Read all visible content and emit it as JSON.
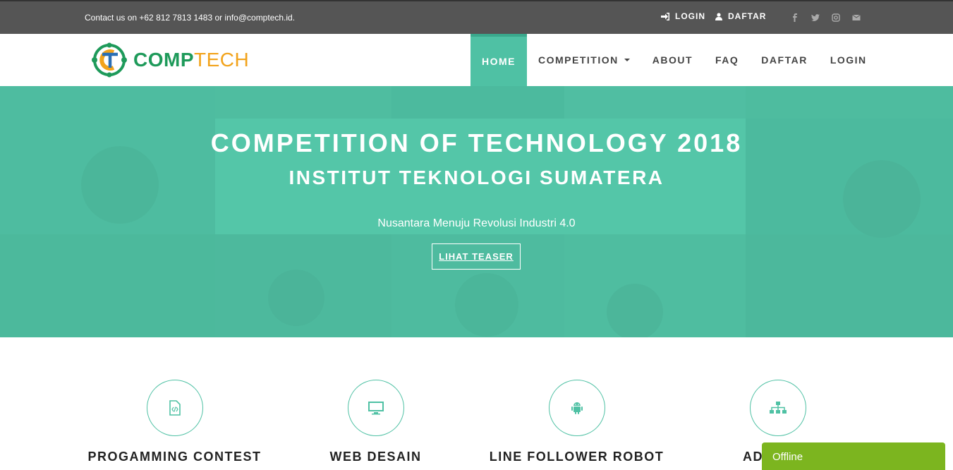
{
  "topbar": {
    "contact": "Contact us on +62 812 7813 1483 or info@comptech.id.",
    "login_label": "LOGIN",
    "daftar_label": "DAFTAR",
    "social": [
      "facebook-icon",
      "twitter-icon",
      "instagram-icon",
      "envelope-icon"
    ]
  },
  "brand": {
    "logo_part1": "COMP",
    "logo_part2": "TECH",
    "color_green": "#1e9a5a",
    "color_orange": "#f2a31b"
  },
  "nav": {
    "items": [
      {
        "label": "HOME",
        "active": true
      },
      {
        "label": "COMPETITION",
        "dropdown": true
      },
      {
        "label": "ABOUT"
      },
      {
        "label": "FAQ"
      },
      {
        "label": "DAFTAR"
      },
      {
        "label": "LOGIN"
      }
    ],
    "accent": "#4fc1a4"
  },
  "hero": {
    "title": "COMPETITION OF TECHNOLOGY 2018",
    "subtitle": "INSTITUT TEKNOLOGI SUMATERA",
    "tagline": "Nusantara Menuju Revolusi Industri 4.0",
    "button_label": "LIHAT TEASER"
  },
  "features": [
    {
      "title": "PROGAMMING CONTEST",
      "icon": "code-file-icon"
    },
    {
      "title": "WEB DESAIN",
      "icon": "monitor-icon"
    },
    {
      "title": "LINE FOLLOWER ROBOT",
      "icon": "android-icon"
    },
    {
      "title": "ADMINIST",
      "icon": "sitemap-icon"
    }
  ],
  "chat": {
    "status": "Offline",
    "color": "#7cb51f"
  }
}
